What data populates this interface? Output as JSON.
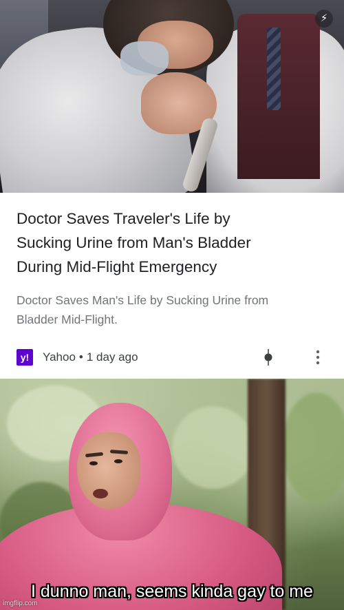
{
  "news_card": {
    "headline_lines": [
      "Doctor Saves Traveler's Life by",
      "Sucking Urine from Man's Bladder",
      "During Mid-Flight Emergency"
    ],
    "snippet_lines": [
      "Doctor Saves Man's Life by Sucking Urine from",
      "Bladder Mid-Flight."
    ],
    "source": {
      "logo_text": "y!",
      "name": "Yahoo",
      "separator": "•",
      "age": "1 day ago"
    },
    "icons": {
      "amp_badge": "lightning-bolt-icon",
      "discover": "discover-icon",
      "more": "more-vertical-icon"
    },
    "colors": {
      "yahoo_purple": "#5f01d1",
      "headline": "#202124",
      "snippet": "#70757a"
    }
  },
  "meme": {
    "caption": "I dunno man, seems kinda gay to me",
    "watermark": "imgflip.com"
  }
}
